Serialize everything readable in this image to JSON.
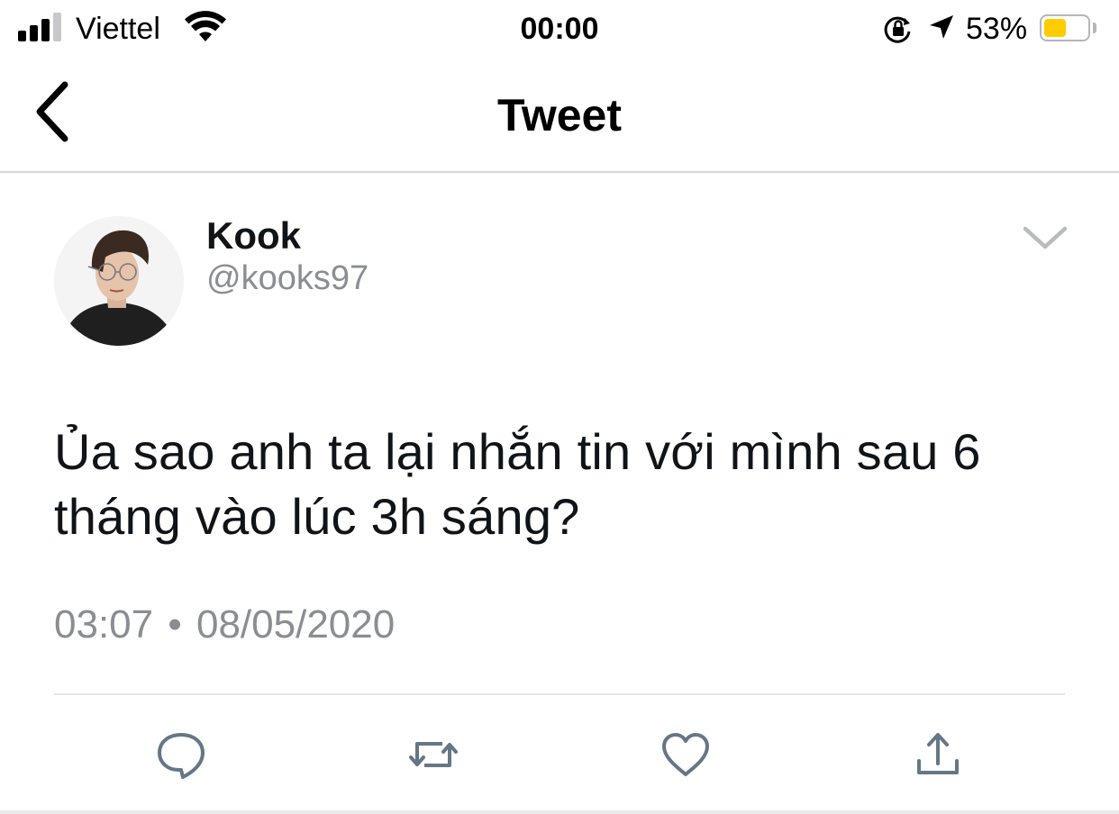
{
  "status_bar": {
    "carrier": "Viettel",
    "time": "00:00",
    "battery_percent_label": "53%",
    "battery_level": 0.53,
    "signal_bars_active": 3,
    "signal_bars_total": 4,
    "battery_color": "#ffcc00",
    "icons": [
      "signal-icon",
      "wifi-icon",
      "orientation-lock-icon",
      "location-arrow-icon",
      "battery-icon"
    ]
  },
  "nav": {
    "title": "Tweet",
    "back_icon": "chevron-left-icon"
  },
  "tweet": {
    "author_name": "Kook",
    "author_handle": "@kooks97",
    "text_line_1": "Ủa sao anh ta lại nhắn tin với mình sau 6",
    "text_line_2": "tháng vào lúc 3h sáng?",
    "time": "03:07",
    "separator": "•",
    "date": "08/05/2020",
    "menu_icon": "chevron-down-icon"
  },
  "actions": [
    {
      "name": "reply",
      "icon": "speech-bubble-icon"
    },
    {
      "name": "retweet",
      "icon": "retweet-arrows-icon"
    },
    {
      "name": "like",
      "icon": "heart-icon"
    },
    {
      "name": "share",
      "icon": "share-upload-icon"
    }
  ],
  "colors": {
    "text_primary": "#0f1419",
    "text_secondary": "#8a8d91",
    "icon_gray": "#657786",
    "divider": "#e1e4e8"
  }
}
